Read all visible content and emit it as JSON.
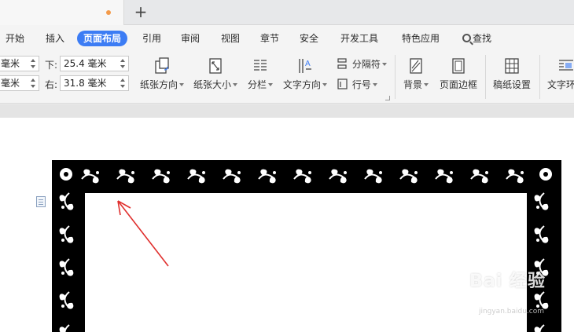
{
  "menu": {
    "items": [
      "开始",
      "插入",
      "页面布局",
      "引用",
      "审阅",
      "视图",
      "章节",
      "安全",
      "开发工具",
      "特色应用"
    ],
    "active": "页面布局",
    "search_label": "查找"
  },
  "ribbon": {
    "margins": {
      "top_left_value": "毫米",
      "bottom_left_value": "毫米",
      "bottom_label": "下:",
      "bottom_value": "25.4 毫米",
      "right_label": "右:",
      "right_value": "31.8 毫米"
    },
    "buttons": {
      "orientation": "纸张方向",
      "size": "纸张大小",
      "columns": "分栏",
      "text_direction": "文字方向",
      "separator": "分隔符",
      "line_number": "行号",
      "background": "背景",
      "page_border": "页面边框",
      "manuscript": "稿纸设置",
      "text_wrap": "文字环"
    }
  },
  "watermark": {
    "main": "Bai 经验",
    "sub": "jingyan.baidu.com"
  },
  "colors": {
    "accent": "#3c7cf4",
    "tab_dot": "#f39a4a",
    "arrow": "#e0302e",
    "border_black": "#000000"
  }
}
